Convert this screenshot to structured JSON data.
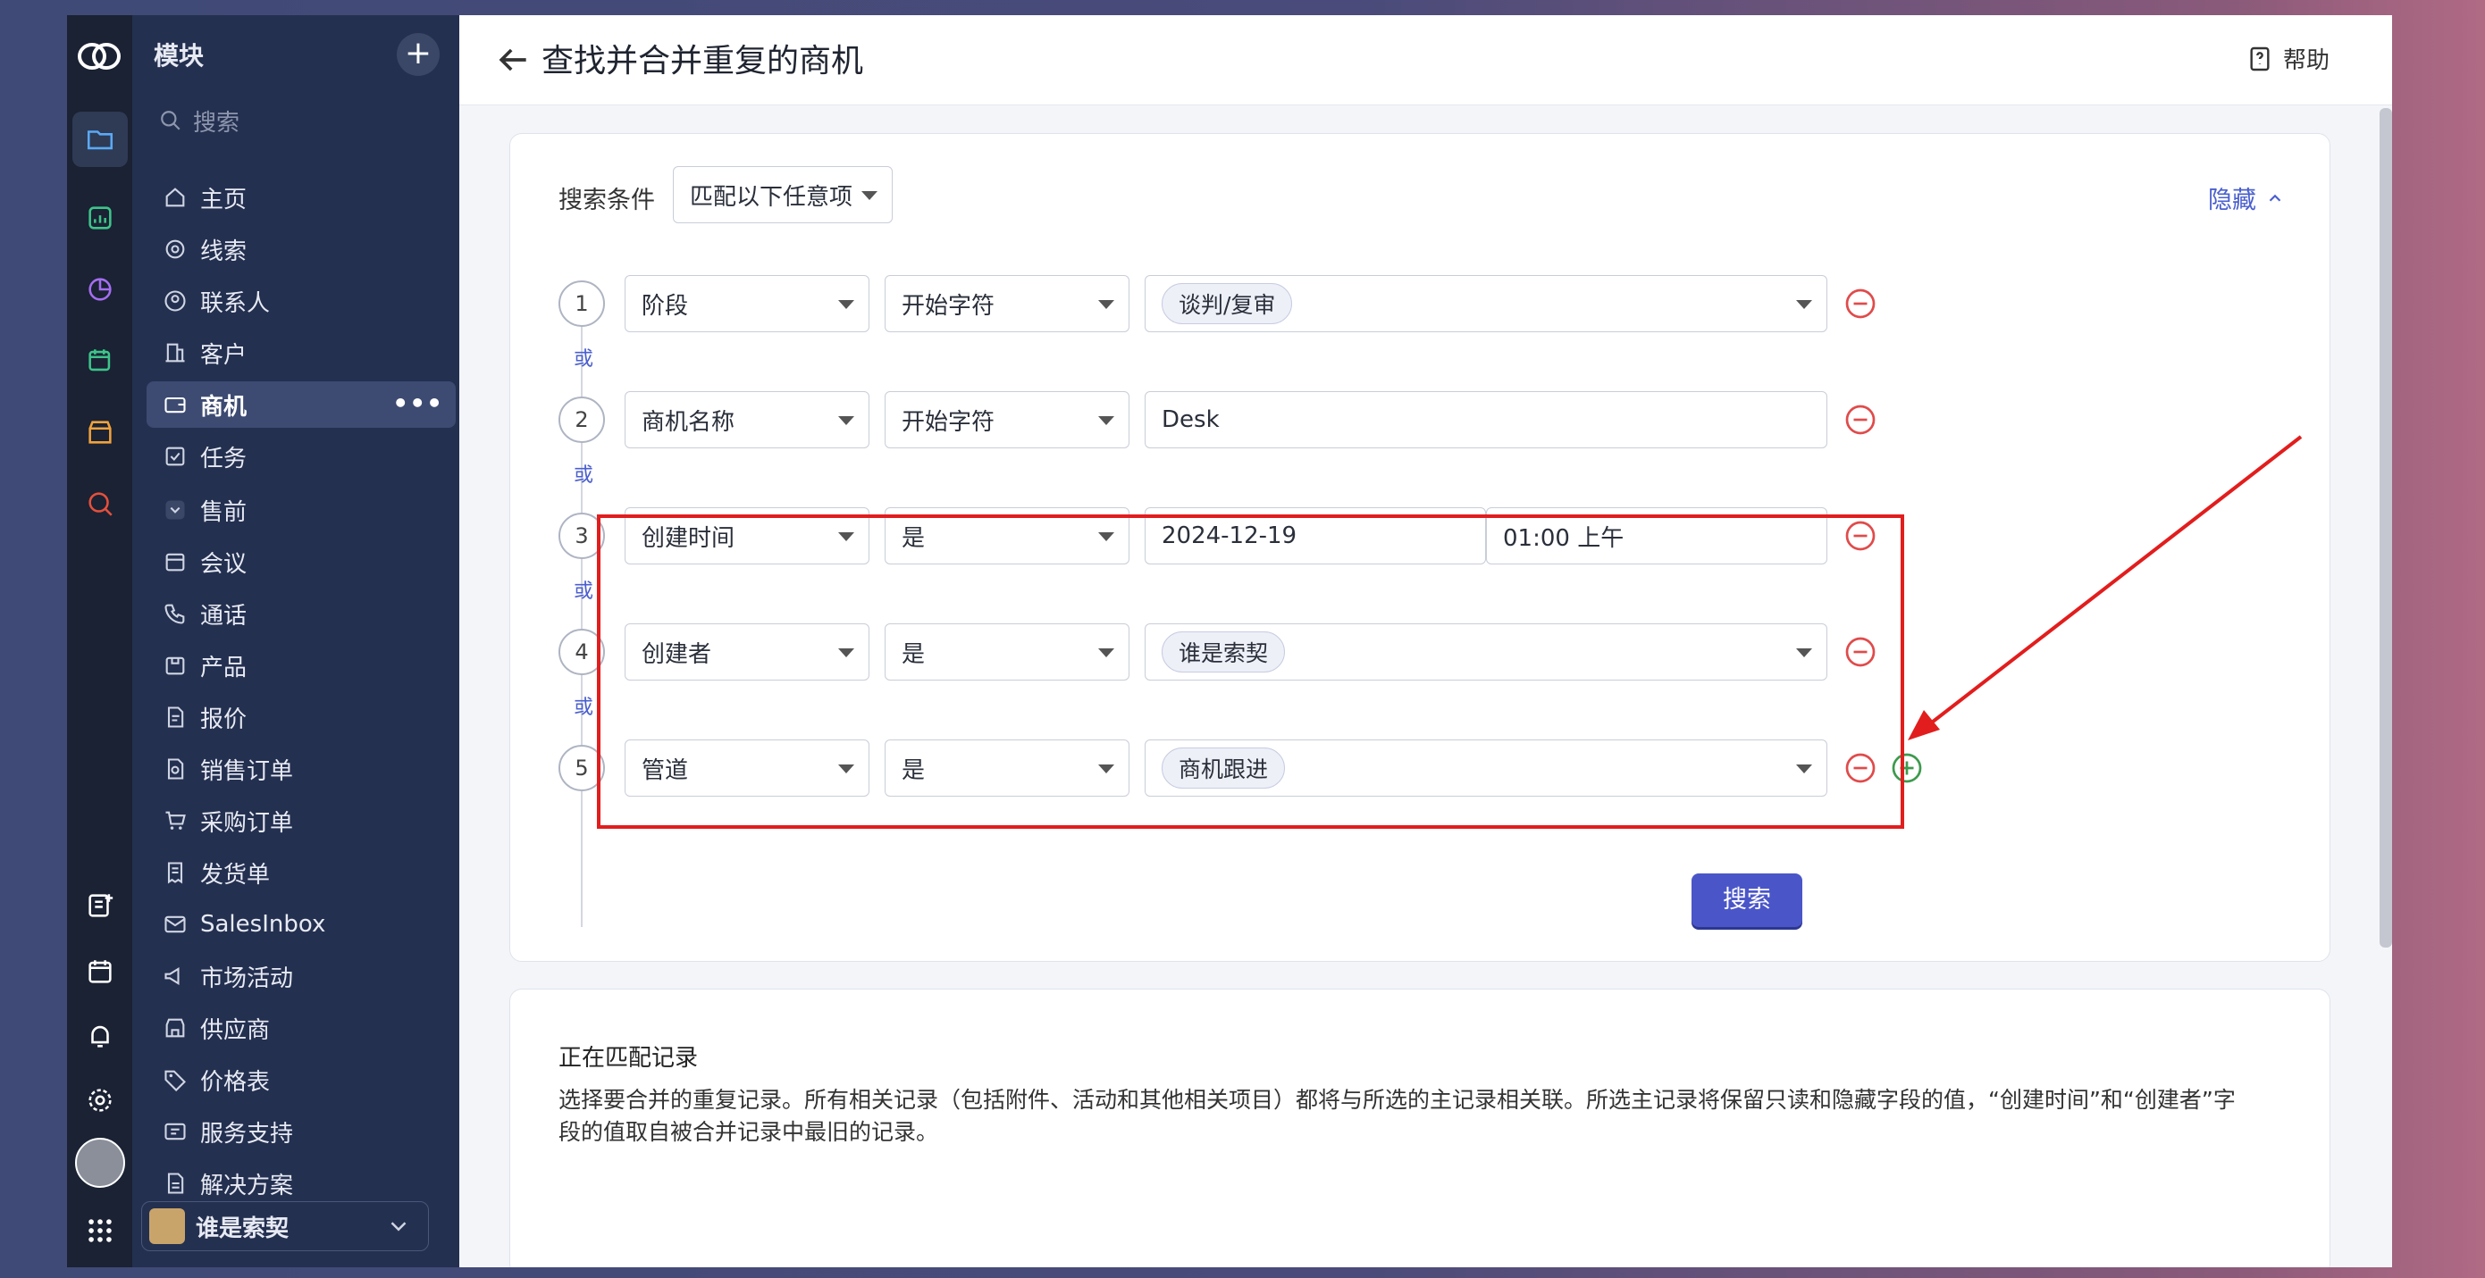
{
  "sidebar": {
    "header": "模块",
    "search_placeholder": "搜索",
    "items": [
      {
        "label": "主页"
      },
      {
        "label": "线索"
      },
      {
        "label": "联系人"
      },
      {
        "label": "客户"
      },
      {
        "label": "商机"
      },
      {
        "label": "任务"
      },
      {
        "label": "售前"
      },
      {
        "label": "会议"
      },
      {
        "label": "通话"
      },
      {
        "label": "产品"
      },
      {
        "label": "报价"
      },
      {
        "label": "销售订单"
      },
      {
        "label": "采购订单"
      },
      {
        "label": "发货单"
      },
      {
        "label": "SalesInbox"
      },
      {
        "label": "市场活动"
      },
      {
        "label": "供应商"
      },
      {
        "label": "价格表"
      },
      {
        "label": "服务支持"
      },
      {
        "label": "解决方案"
      }
    ],
    "active_item": "商机",
    "more_glyph": "•••",
    "user_name": "谁是索契"
  },
  "header": {
    "title": "查找并合并重复的商机",
    "help_label": "帮助"
  },
  "search": {
    "conditions_label": "搜索条件",
    "match_mode": "匹配以下任意项",
    "hide_label": "隐藏",
    "or_label": "或",
    "rows": [
      {
        "num": "1",
        "field": "阶段",
        "operator": "开始字符",
        "value_chip": "谈判/复审"
      },
      {
        "num": "2",
        "field": "商机名称",
        "operator": "开始字符",
        "value_text": "Desk"
      },
      {
        "num": "3",
        "field": "创建时间",
        "operator": "是",
        "date": "2024-12-19",
        "time": "01:00 上午"
      },
      {
        "num": "4",
        "field": "创建者",
        "operator": "是",
        "value_chip": "谁是索契"
      },
      {
        "num": "5",
        "field": "管道",
        "operator": "是",
        "value_chip": "商机跟进"
      }
    ],
    "search_button": "搜索"
  },
  "matching": {
    "title": "正在匹配记录",
    "description": "选择要合并的重复记录。所有相关记录（包括附件、活动和其他相关项目）都将与所选的主记录相关联。所选主记录将保留只读和隐藏字段的值，“创建时间”和“创建者”字段的值取自被合并记录中最旧的记录。"
  },
  "colors": {
    "accent": "#4a56c8",
    "highlight_box": "#e21d1d",
    "remove_icon": "#e04b4b",
    "add_icon": "#3e9a4e"
  }
}
